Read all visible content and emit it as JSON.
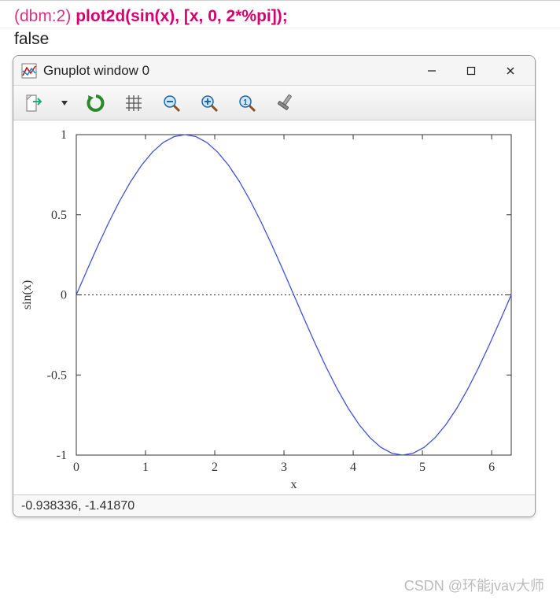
{
  "command": {
    "prompt": "(dbm:2)",
    "text": "plot2d(sin(x), [x, 0, 2*%pi]);",
    "result": "false"
  },
  "window": {
    "title": "Gnuplot window 0",
    "controls": {
      "minimize": "—",
      "maximize": "▢",
      "close": "✕"
    }
  },
  "toolbar": {
    "items": [
      "export",
      "dropdown",
      "reload",
      "grid",
      "zoom-out",
      "zoom-in",
      "zoom-1",
      "settings"
    ]
  },
  "status": "-0.938336, -1.41870",
  "watermark": "CSDN @环能jvav大师",
  "chart_data": {
    "type": "line",
    "xlabel": "x",
    "ylabel": "sin(x)",
    "xlim": [
      0,
      6.2832
    ],
    "ylim": [
      -1,
      1
    ],
    "xticks": [
      0,
      1,
      2,
      3,
      4,
      5,
      6
    ],
    "yticks": [
      -1,
      -0.5,
      0,
      0.5,
      1
    ],
    "series": [
      {
        "name": "sin(x)",
        "color": "#4050d8",
        "x": [
          0,
          0.1571,
          0.3142,
          0.4712,
          0.6283,
          0.7854,
          0.9425,
          1.0996,
          1.2566,
          1.4137,
          1.5708,
          1.7279,
          1.885,
          2.042,
          2.1991,
          2.3562,
          2.5133,
          2.6704,
          2.8274,
          2.9845,
          3.1416,
          3.2987,
          3.4558,
          3.6128,
          3.7699,
          3.927,
          4.0841,
          4.2412,
          4.3982,
          4.5553,
          4.7124,
          4.8695,
          5.0265,
          5.1836,
          5.3407,
          5.4978,
          5.6549,
          5.8119,
          5.969,
          6.1261,
          6.2832
        ],
        "y": [
          0,
          0.1564,
          0.309,
          0.454,
          0.5878,
          0.7071,
          0.809,
          0.891,
          0.9511,
          0.9877,
          1.0,
          0.9877,
          0.9511,
          0.891,
          0.809,
          0.7071,
          0.5878,
          0.454,
          0.309,
          0.1564,
          0.0,
          -0.1564,
          -0.309,
          -0.454,
          -0.5878,
          -0.7071,
          -0.809,
          -0.891,
          -0.9511,
          -0.9877,
          -1.0,
          -0.9877,
          -0.9511,
          -0.891,
          -0.809,
          -0.7071,
          -0.5878,
          -0.454,
          -0.309,
          -0.1564,
          0.0
        ]
      }
    ],
    "baseline_y": 0
  }
}
